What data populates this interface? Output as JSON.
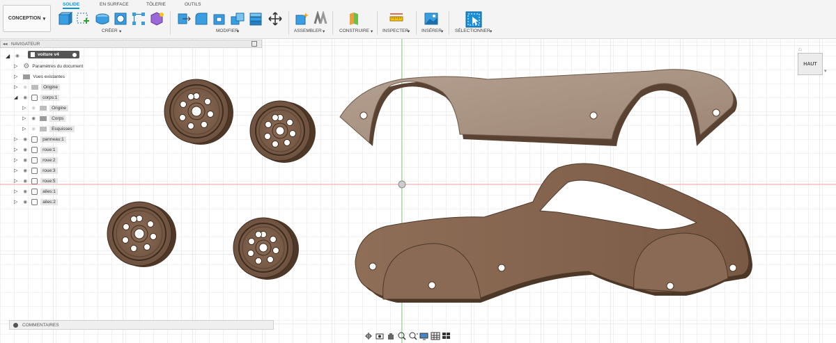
{
  "workspace": {
    "label": "CONCEPTION"
  },
  "tabs": [
    "SOLIDE",
    "EN SURFACE",
    "TÔLERIE",
    "OUTILS"
  ],
  "active_tab": "SOLIDE",
  "toolbar_groups": [
    "CRÉER",
    "MODIFIER",
    "ASSEMBLER",
    "CONSTRUIRE",
    "INSPECTER",
    "INSÉRER",
    "SÉLECTIONNER"
  ],
  "browser": {
    "title": "NAVIGATEUR",
    "root": "voiture v4",
    "items": [
      {
        "label": "Paramètres du document"
      },
      {
        "label": "Vues existantes"
      },
      {
        "label": "Origine"
      },
      {
        "label": "corps:1"
      },
      {
        "label": "Origine"
      },
      {
        "label": "Corps"
      },
      {
        "label": "Esquisses"
      },
      {
        "label": "panneau:1"
      },
      {
        "label": "roue:1"
      },
      {
        "label": "roue:2"
      },
      {
        "label": "roue:3"
      },
      {
        "label": "roue:5"
      },
      {
        "label": "ailes:1"
      },
      {
        "label": "ailes:2"
      }
    ]
  },
  "comments": {
    "label": "COMMENTAIRES"
  },
  "viewcube": {
    "label": "HAUT"
  },
  "colors": {
    "accent": "#0696d7",
    "wood": "#7a5a44",
    "wood_light": "#a8907e",
    "grid": "#e6e6e6"
  }
}
